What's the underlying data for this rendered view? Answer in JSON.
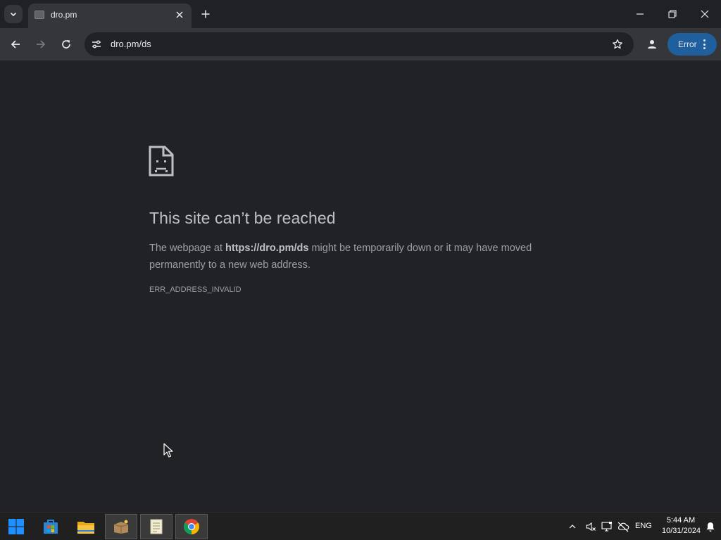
{
  "browser": {
    "tab": {
      "title": "dro.pm"
    },
    "address": {
      "url": "dro.pm/ds"
    },
    "error_chip": {
      "label": "Error"
    }
  },
  "error_page": {
    "title": "This site can’t be reached",
    "desc_before": "The webpage at ",
    "desc_url": "https://dro.pm/ds",
    "desc_after": " might be temporarily down or it may have moved permanently to a new web address.",
    "code": "ERR_ADDRESS_INVALID"
  },
  "taskbar": {
    "apps": [
      "start-icon",
      "store-icon",
      "file-explorer-icon",
      "package-icon",
      "notepad-icon",
      "chrome-icon"
    ],
    "tray": {
      "language": "ENG",
      "time": "5:44 AM",
      "date": "10/31/2024"
    }
  },
  "colors": {
    "page_bg": "#212226",
    "chip_bg": "#1f5f9e",
    "title_text": "#bdc1c6",
    "body_text": "#9aa0a6"
  }
}
